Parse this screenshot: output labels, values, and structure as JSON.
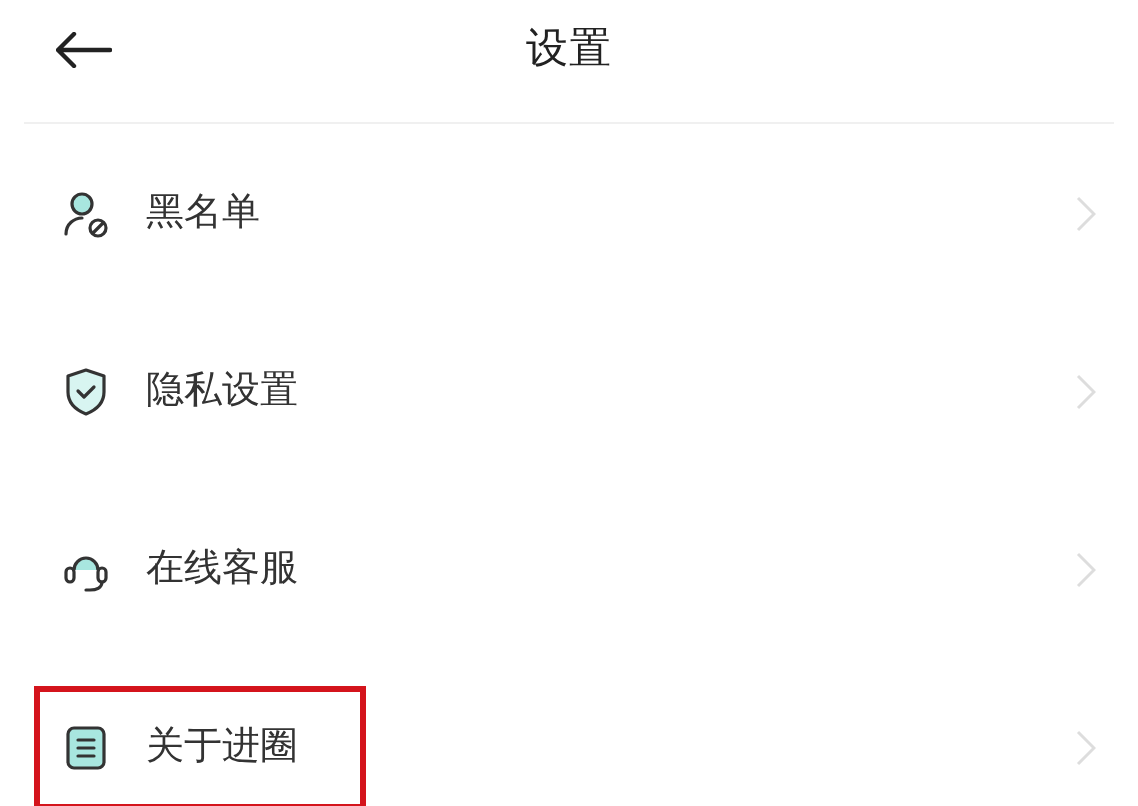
{
  "header": {
    "title": "设置"
  },
  "items": [
    {
      "kind": "blocklist",
      "label": "黑名单",
      "highlighted": false
    },
    {
      "kind": "privacy",
      "label": "隐私设置",
      "highlighted": false
    },
    {
      "kind": "support",
      "label": "在线客服",
      "highlighted": false
    },
    {
      "kind": "about",
      "label": "关于进圈",
      "highlighted": true
    }
  ]
}
